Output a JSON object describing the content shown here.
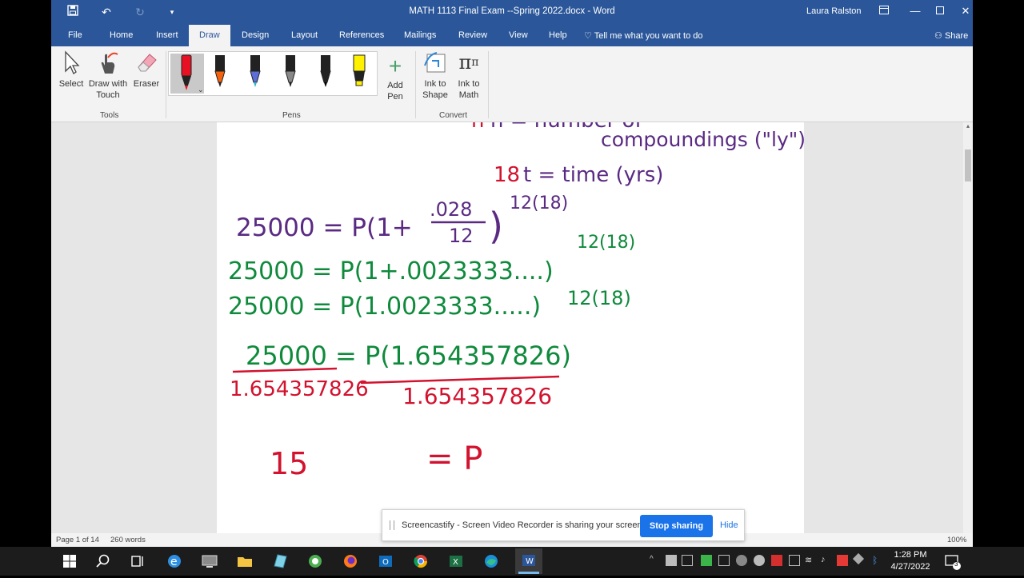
{
  "window": {
    "title": "MATH 1113 Final Exam --Spring 2022.docx  -  Word",
    "user": "Laura Ralston",
    "share_label": "Share",
    "tell_me": "Tell me what you want to do"
  },
  "tabs": [
    "File",
    "Home",
    "Insert",
    "Draw",
    "Design",
    "Layout",
    "References",
    "Mailings",
    "Review",
    "View",
    "Help"
  ],
  "active_tab": "Draw",
  "ribbon": {
    "tools": {
      "select": "Select",
      "draw_touch": "Draw with Touch",
      "eraser": "Eraser",
      "group": "Tools"
    },
    "pens": {
      "add_pen": "Add Pen",
      "group": "Pens",
      "colors": [
        "#e81123",
        "#f7630c",
        "#3a5ed6",
        "#777777",
        "#111111",
        "#fff100"
      ]
    },
    "convert": {
      "ink_shape": "Ink to Shape",
      "ink_math": "Ink to Math",
      "group": "Convert"
    }
  },
  "document": {
    "ink_lines": {
      "top_cutoff": "n = number of",
      "compoundings": "compoundings (\"ly\")",
      "time_value": "18",
      "time_def": "t = time (yrs)",
      "eq1_lhs": "25000 = P(1+",
      "eq1_num": ".028",
      "eq1_den": "12",
      "eq1_exp": "12(18)",
      "eq2": "25000 = P(1+.0023333....)",
      "eq2_exp": "12(18)",
      "eq3": "25000 = P(1.0023333.....)",
      "eq3_exp": "12(18)",
      "eq4": "25000 = P(1.654357826)",
      "div_left": "1.654357826",
      "div_right": "1.654357826",
      "result_left": "15",
      "result_right": "= P"
    },
    "ink_colors": {
      "purple": "#5a2a83",
      "green": "#0f8a3c",
      "red": "#d2122e"
    }
  },
  "status": {
    "page": "Page 1 of 14",
    "words": "260 words",
    "zoom": "100%"
  },
  "sharebar": {
    "message": "Screencastify - Screen Video Recorder is sharing your screen.",
    "stop": "Stop sharing",
    "hide": "Hide"
  },
  "taskbar": {
    "time": "1:28 PM",
    "date": "4/27/2022",
    "notifications": "3"
  }
}
